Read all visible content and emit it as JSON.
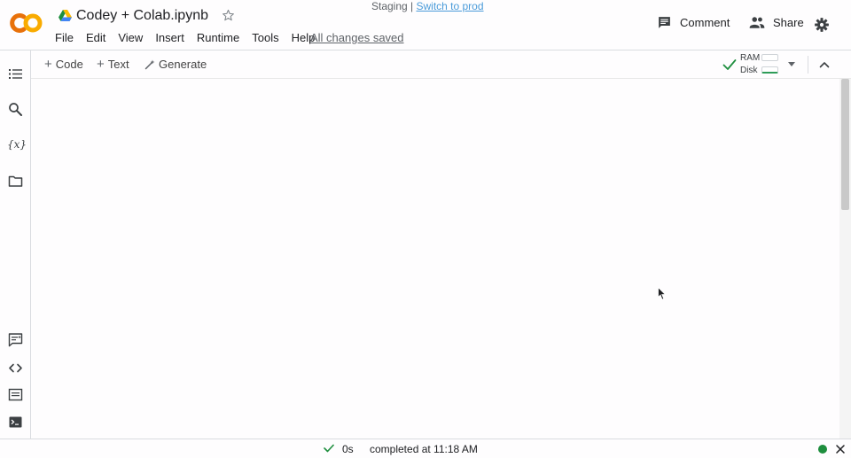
{
  "header": {
    "notebook_title": "Codey + Colab.ipynb",
    "menu": [
      "File",
      "Edit",
      "View",
      "Insert",
      "Runtime",
      "Tools",
      "Help"
    ],
    "save_status": "All changes saved",
    "staging_text": "Staging | ",
    "switch_link": "Switch to prod",
    "comment_label": "Comment",
    "share_label": "Share"
  },
  "toolbar": {
    "code_label": "Code",
    "text_label": "Text",
    "generate_label": "Generate",
    "ram_label": "RAM",
    "disk_label": "Disk"
  },
  "sidebar": {
    "icons": [
      "table-of-contents-icon",
      "search-icon",
      "variables-icon",
      "files-icon",
      "command-palette-icon",
      "code-snippets-icon",
      "terminal-icon"
    ]
  },
  "status": {
    "elapsed": "0s",
    "message": "completed at 11:18 AM",
    "connection_color": "#1e8e3e"
  },
  "colors": {
    "logo_orange": "#f9ab00",
    "logo_dark_orange": "#e8710a",
    "link_blue": "#4a9bd9",
    "check_green": "#1e8e3e"
  }
}
